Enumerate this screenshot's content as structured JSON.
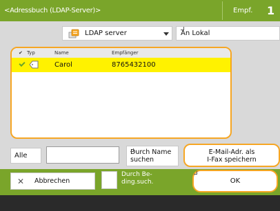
{
  "header": {
    "title": "<Adressbuch (LDAP-Server)>",
    "recipient_label": "Empf.",
    "recipient_count": "1"
  },
  "source": {
    "selected": "LDAP server",
    "icon": "database-icon"
  },
  "lokal_button": "An Lokal",
  "list": {
    "columns": {
      "check": "✔",
      "type": "Typ",
      "name": "Name",
      "recipient": "Empfänger"
    },
    "rows": [
      {
        "selected": true,
        "type_icon": "email-tag-icon",
        "name": "Carol",
        "recipient": "8765432100"
      }
    ]
  },
  "search": {
    "all_label": "Alle",
    "input_value": "",
    "name_search_line1": "Durch Name",
    "name_search_line2": "suchen",
    "save_line1": "E-Mail-Adr. als",
    "save_line2": "I-Fax speichern"
  },
  "footer": {
    "cancel_label": "Abbrechen",
    "condition_line1": "Durch Be-",
    "condition_line2": "ding.such.",
    "ok_label": "OK"
  },
  "colors": {
    "header_green": "#7aa52a",
    "highlight_orange": "#f6a623",
    "selected_row": "#fff200"
  }
}
